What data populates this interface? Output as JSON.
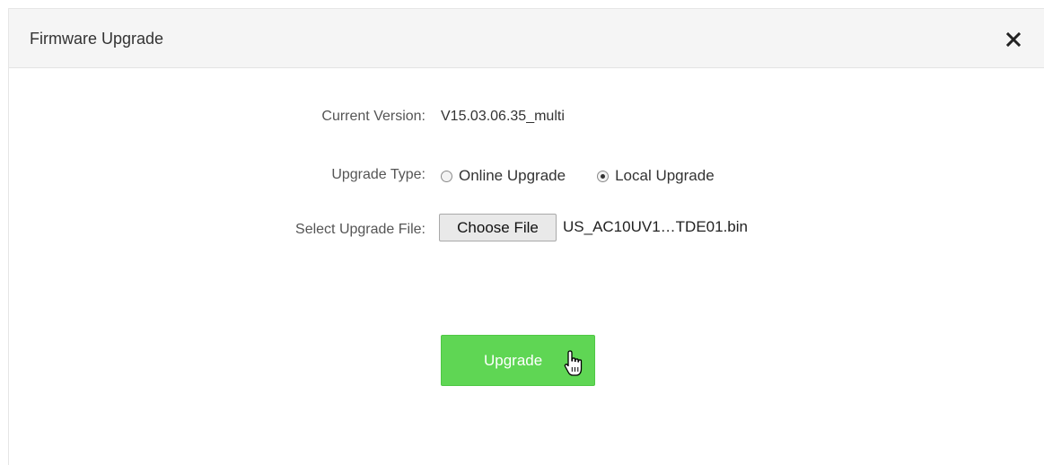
{
  "dialog": {
    "title": "Firmware Upgrade",
    "close_icon": "close-icon"
  },
  "form": {
    "current_version": {
      "label": "Current Version:",
      "value": "V15.03.06.35_multi"
    },
    "upgrade_type": {
      "label": "Upgrade Type:",
      "options": [
        {
          "label": "Online Upgrade",
          "selected": false
        },
        {
          "label": "Local Upgrade",
          "selected": true
        }
      ]
    },
    "upgrade_file": {
      "label": "Select Upgrade File:",
      "button_label": "Choose File",
      "file_name": "US_AC10UV1…TDE01.bin"
    }
  },
  "actions": {
    "upgrade_label": "Upgrade",
    "cursor_icon": "hand-pointer-icon"
  },
  "colors": {
    "primary": "#5fd654",
    "header_bg": "#f5f5f5"
  }
}
